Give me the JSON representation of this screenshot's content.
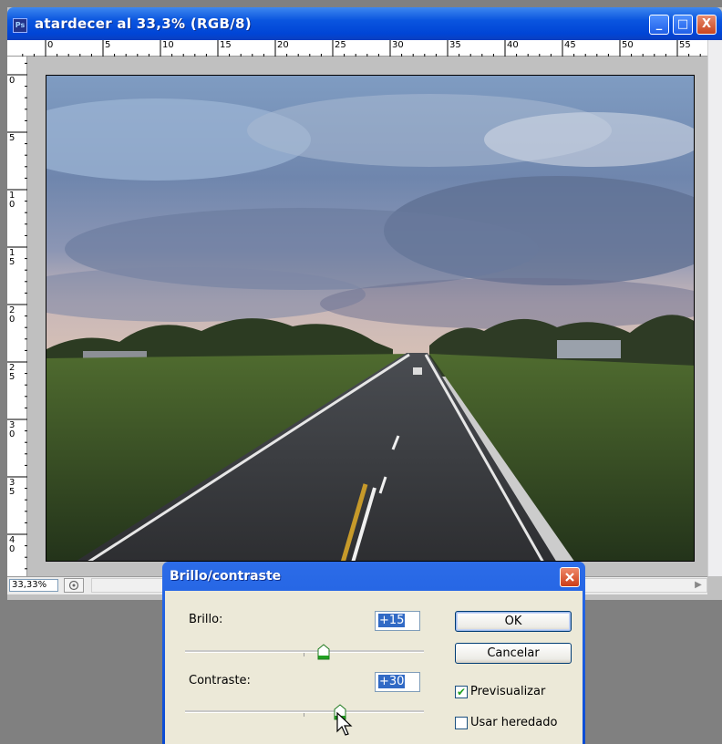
{
  "document": {
    "title": "atardecer al 33,3% (RGB/8)",
    "app_icon_text": "Ps",
    "window_buttons": {
      "minimize": "_",
      "maximize": "□",
      "close": "X"
    },
    "ruler_top_labels": [
      "0",
      "5",
      "10",
      "15",
      "20",
      "25",
      "30",
      "35",
      "40",
      "45",
      "50",
      "55"
    ],
    "ruler_left_labels": [
      "0",
      "5",
      "10",
      "15",
      "20",
      "25",
      "30",
      "35",
      "40"
    ],
    "zoom": "33,33%",
    "status_icon": "info-icon"
  },
  "dialog": {
    "title": "Brillo/contraste",
    "brightness": {
      "label": "Brillo:",
      "value": "+15",
      "slider_fraction": 0.58
    },
    "contrast": {
      "label": "Contraste:",
      "value": "+30",
      "slider_fraction": 0.65
    },
    "buttons": {
      "ok": "OK",
      "cancel": "Cancelar"
    },
    "checkboxes": {
      "preview": {
        "label": "Previsualizar",
        "checked": true
      },
      "legacy": {
        "label": "Usar heredado",
        "checked": false
      }
    }
  },
  "colors": {
    "titlebar": "#0a55df",
    "dialog_face": "#ece9d8",
    "selection": "#316ac5"
  }
}
